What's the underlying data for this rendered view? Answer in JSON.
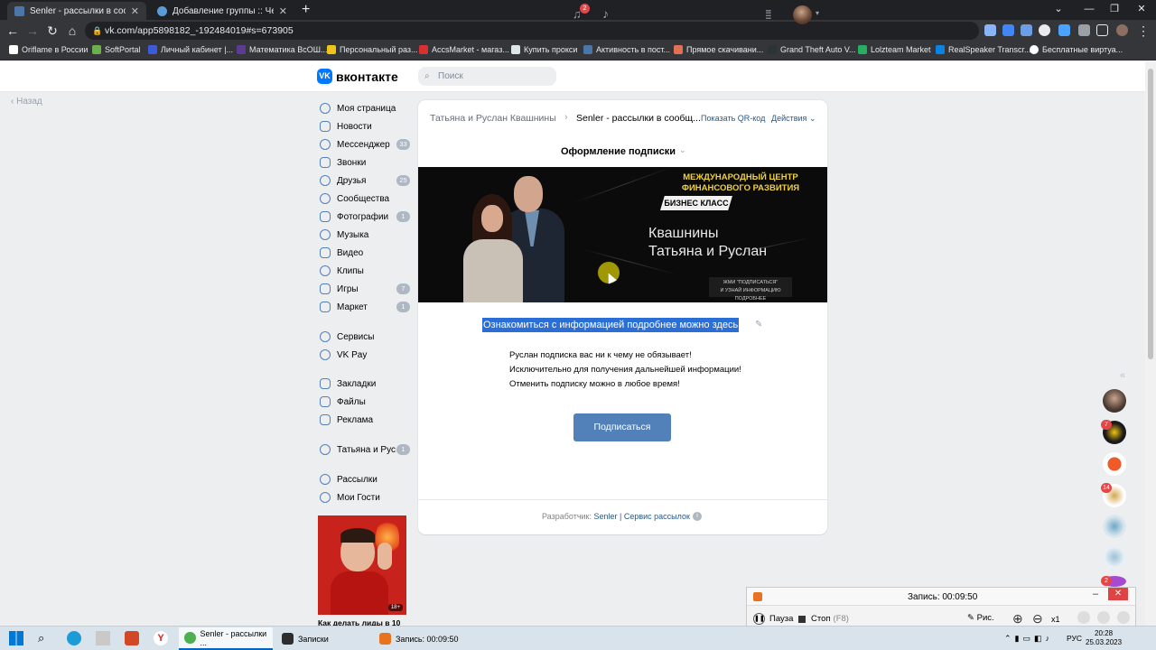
{
  "browser": {
    "tabs": [
      {
        "title": "Senler - рассылки в сообществ",
        "active": true
      },
      {
        "title": "Добавление группы :: Черновик",
        "active": false
      }
    ],
    "url": "vk.com/app5898182_-192484019#s=673905",
    "bookmarks": [
      "Oriflame в России",
      "SoftPortal",
      "Личный кабинет |...",
      "Математика ВсОШ...",
      "Персональный раз...",
      "AccsMarket - магаз...",
      "Купить прокси",
      "Активность в пост...",
      "Прямое скачивани...",
      "Grand Theft Auto V...",
      "Lolzteam Market",
      "RealSpeaker Transcr...",
      "Бесплатные виртуа..."
    ]
  },
  "vk": {
    "logo_text": "вконтакте",
    "search_placeholder": "Поиск",
    "notif_count": "2",
    "back_label": "Назад",
    "menu": [
      {
        "label": "Моя страница",
        "count": ""
      },
      {
        "label": "Новости",
        "count": ""
      },
      {
        "label": "Мессенджер",
        "count": "33"
      },
      {
        "label": "Звонки",
        "count": ""
      },
      {
        "label": "Друзья",
        "count": "25"
      },
      {
        "label": "Сообщества",
        "count": ""
      },
      {
        "label": "Фотографии",
        "count": "1"
      },
      {
        "label": "Музыка",
        "count": ""
      },
      {
        "label": "Видео",
        "count": ""
      },
      {
        "label": "Клипы",
        "count": ""
      },
      {
        "label": "Игры",
        "count": "7"
      },
      {
        "label": "Маркет",
        "count": "1"
      },
      {
        "label": "Сервисы",
        "count": ""
      },
      {
        "label": "VK Pay",
        "count": ""
      },
      {
        "label": "Закладки",
        "count": ""
      },
      {
        "label": "Файлы",
        "count": ""
      },
      {
        "label": "Реклама",
        "count": ""
      },
      {
        "label": "Татьяна и Рус...",
        "count": "1"
      },
      {
        "label": "Рассылки",
        "count": ""
      },
      {
        "label": "Мои Гости",
        "count": ""
      }
    ],
    "promo": {
      "caption": "Как делать лиды в 10",
      "age": "18+"
    }
  },
  "app": {
    "breadcrumb_group": "Татьяна и Руслан Квашнины",
    "breadcrumb_app": "Senler - рассылки в сообщ...",
    "qr_label": "Показать QR-код",
    "actions_label": "Действия",
    "subtitle": "Оформление подписки",
    "banner": {
      "line1": "МЕЖДУНАРОДНЫЙ ЦЕНТР",
      "line2": "ФИНАНСОВОГО РАЗВИТИЯ",
      "badge": "БИЗНЕС КЛАСС",
      "name1": "Квашнины",
      "name2": "Татьяна и Руслан",
      "small1": "ЖМИ \"ПОДПИСАТЬСЯ\"",
      "small2": "И УЗНАЙ ИНФОРМАЦИЮ ПОДРОБНЕЕ"
    },
    "info_link": "Ознакомиться с информацией подробнее можно здесь",
    "lines": [
      "Руслан подписка вас ни к чему не обязывает!",
      "Исключительно для получения дальнейшей информации!",
      "Отменить подписку можно в любое время!"
    ],
    "subscribe_label": "Подписаться",
    "footer_prefix": "Разработчик:",
    "footer_link": "Senler | Сервис рассылок"
  },
  "chats": [
    {
      "badge": ""
    },
    {
      "badge": "7"
    },
    {
      "badge": ""
    },
    {
      "badge": "14"
    },
    {
      "badge": ""
    },
    {
      "badge": ""
    },
    {
      "badge": "2"
    }
  ],
  "recorder": {
    "title": "Запись:  00:09:50",
    "pause": "Пауза",
    "stop": "Стоп",
    "stop_key": "(F8)",
    "draw": "Рис.",
    "speed": "x1"
  },
  "taskbar": {
    "apps": [
      {
        "label": "Senler - рассылки ..."
      },
      {
        "label": "Записки"
      },
      {
        "label": "Запись:  00:09:50"
      }
    ],
    "lang": "РУС",
    "time": "20:28",
    "date": "25.03.2023"
  }
}
